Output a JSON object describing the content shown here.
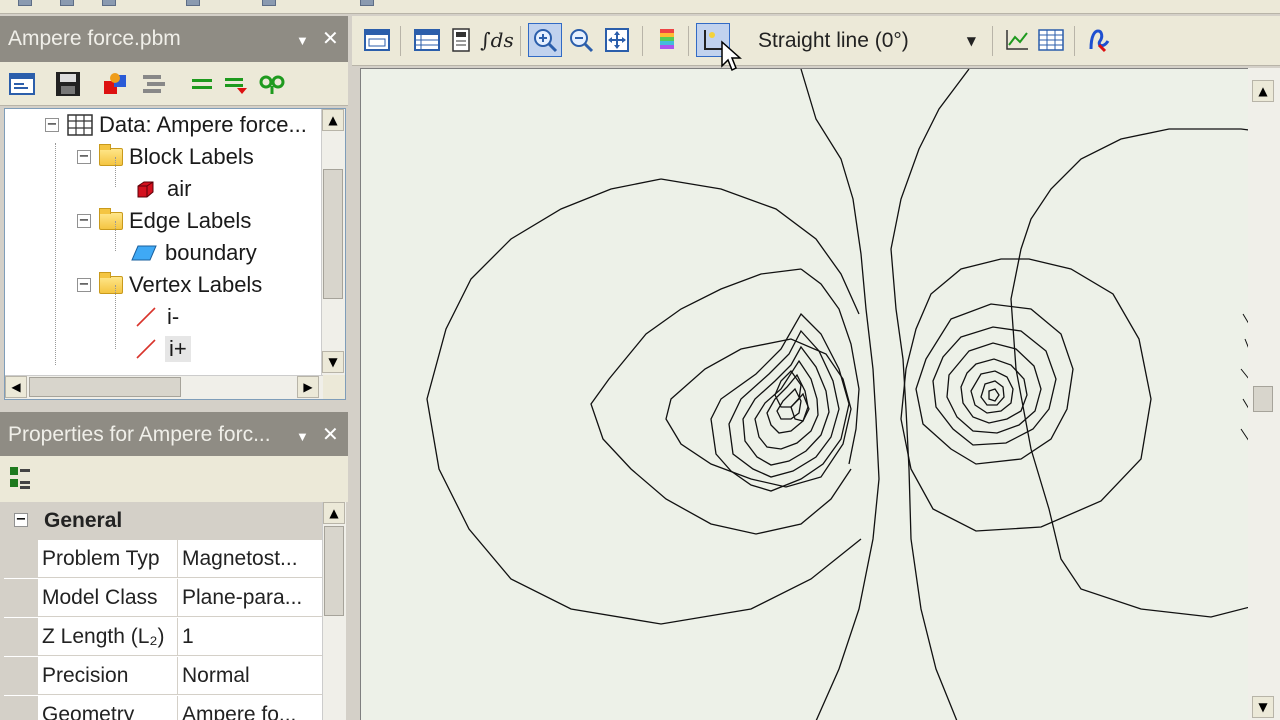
{
  "explorer": {
    "title": "Ampere force.pbm",
    "tree": {
      "data_node": "Data: Ampere force...",
      "block_labels": "Block Labels",
      "air": "air",
      "edge_labels": "Edge Labels",
      "boundary": "boundary",
      "vertex_labels": "Vertex Labels",
      "i_minus": "i-",
      "i_plus": "i+"
    }
  },
  "properties": {
    "title": "Properties for Ampere forc...",
    "category": "General",
    "rows": [
      {
        "name": "Problem Typ",
        "value": "Magnetost..."
      },
      {
        "name": "Model Class",
        "value": "Plane-para..."
      },
      {
        "name": "Z Length (L₂)",
        "value": "1"
      },
      {
        "name": "Precision",
        "value": "Normal"
      },
      {
        "name": "Geometry",
        "value": "Ampere fo..."
      }
    ]
  },
  "view_toolbar": {
    "contour_mode": "Straight line (0°)"
  },
  "colors": {
    "plot_background": "#edf1e8",
    "pane_title": "#8f8c84",
    "toolbar": "#ece9d8",
    "pressed": "#c1d2ee"
  }
}
